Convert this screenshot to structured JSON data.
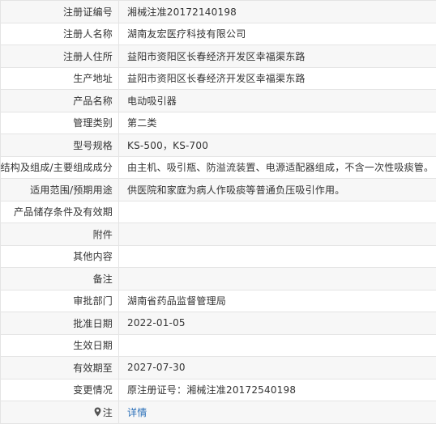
{
  "rows": [
    {
      "label": "注册证编号",
      "value": "湘械注准20172140198"
    },
    {
      "label": "注册人名称",
      "value": "湖南友宏医疗科技有限公司"
    },
    {
      "label": "注册人住所",
      "value": "益阳市资阳区长春经济开发区幸福渠东路"
    },
    {
      "label": "生产地址",
      "value": "益阳市资阳区长春经济开发区幸福渠东路"
    },
    {
      "label": "产品名称",
      "value": "电动吸引器"
    },
    {
      "label": "管理类别",
      "value": "第二类"
    },
    {
      "label": "型号规格",
      "value": "KS-500，KS-700"
    },
    {
      "label": "结构及组成/主要组成成分",
      "value": "由主机、吸引瓶、防溢流装置、电源适配器组成，不含一次性吸痰管。"
    },
    {
      "label": "适用范围/预期用途",
      "value": "供医院和家庭为病人作吸痰等普通负压吸引作用。"
    },
    {
      "label": "产品储存条件及有效期",
      "value": ""
    },
    {
      "label": "附件",
      "value": ""
    },
    {
      "label": "其他内容",
      "value": ""
    },
    {
      "label": "备注",
      "value": ""
    },
    {
      "label": "审批部门",
      "value": "湖南省药品监督管理局"
    },
    {
      "label": "批准日期",
      "value": "2022-01-05"
    },
    {
      "label": "生效日期",
      "value": ""
    },
    {
      "label": "有效期至",
      "value": "2027-07-30"
    },
    {
      "label": "变更情况",
      "value": "原注册证号：湘械注准20172540198"
    }
  ],
  "note_row": {
    "label": "注",
    "icon": "map-pin-icon",
    "link_text": "详情",
    "link_color": "#2a6fb8"
  }
}
